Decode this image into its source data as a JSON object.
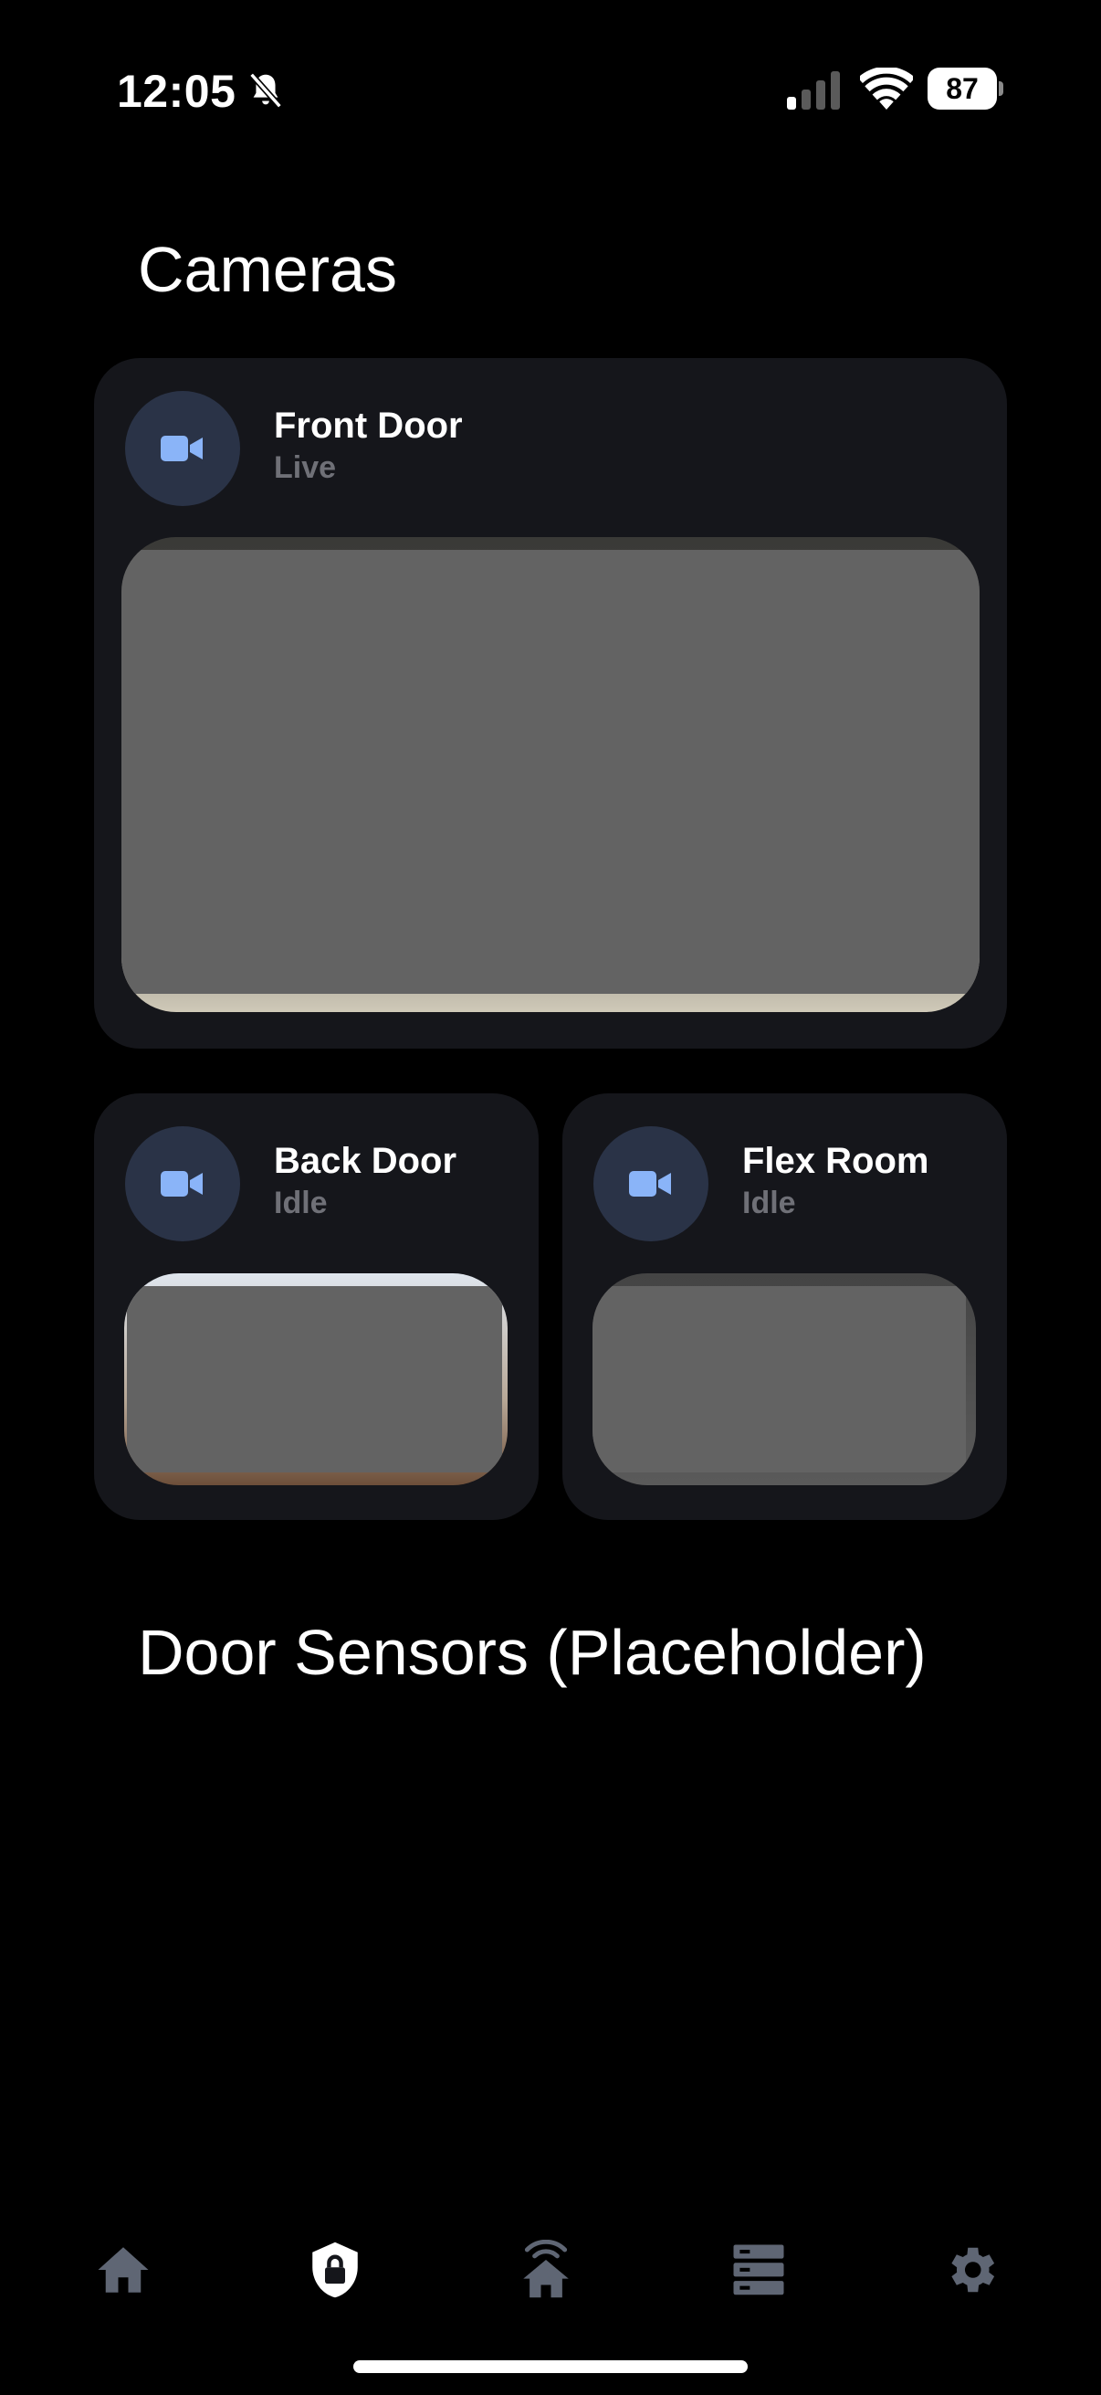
{
  "status_bar": {
    "time": "12:05",
    "battery": "87",
    "icons": [
      "bell-slash-icon",
      "cellular-signal-icon",
      "wifi-icon",
      "battery-icon"
    ]
  },
  "sections": {
    "cameras_title": "Cameras",
    "sensors_title": "Door Sensors (Placeholder)"
  },
  "cameras": [
    {
      "name": "Front Door",
      "status": "Live",
      "icon": "video-camera-icon"
    },
    {
      "name": "Back Door",
      "status": "Idle",
      "icon": "video-camera-icon"
    },
    {
      "name": "Flex Room",
      "status": "Idle",
      "icon": "video-camera-icon"
    }
  ],
  "bottom_nav": {
    "items": [
      {
        "icon": "home-icon",
        "active": false
      },
      {
        "icon": "shield-lock-icon",
        "active": true
      },
      {
        "icon": "home-alarm-icon",
        "active": false
      },
      {
        "icon": "server-stack-icon",
        "active": false
      },
      {
        "icon": "gear-icon",
        "active": false
      }
    ]
  },
  "colors": {
    "background": "#000000",
    "card": "#15161b",
    "icon_circle": "#2a3347",
    "icon_accent": "#8ab4f8",
    "muted_text": "#6f7077",
    "nav_inactive": "#5f6674",
    "nav_active": "#ffffff",
    "redaction": "#636363"
  }
}
